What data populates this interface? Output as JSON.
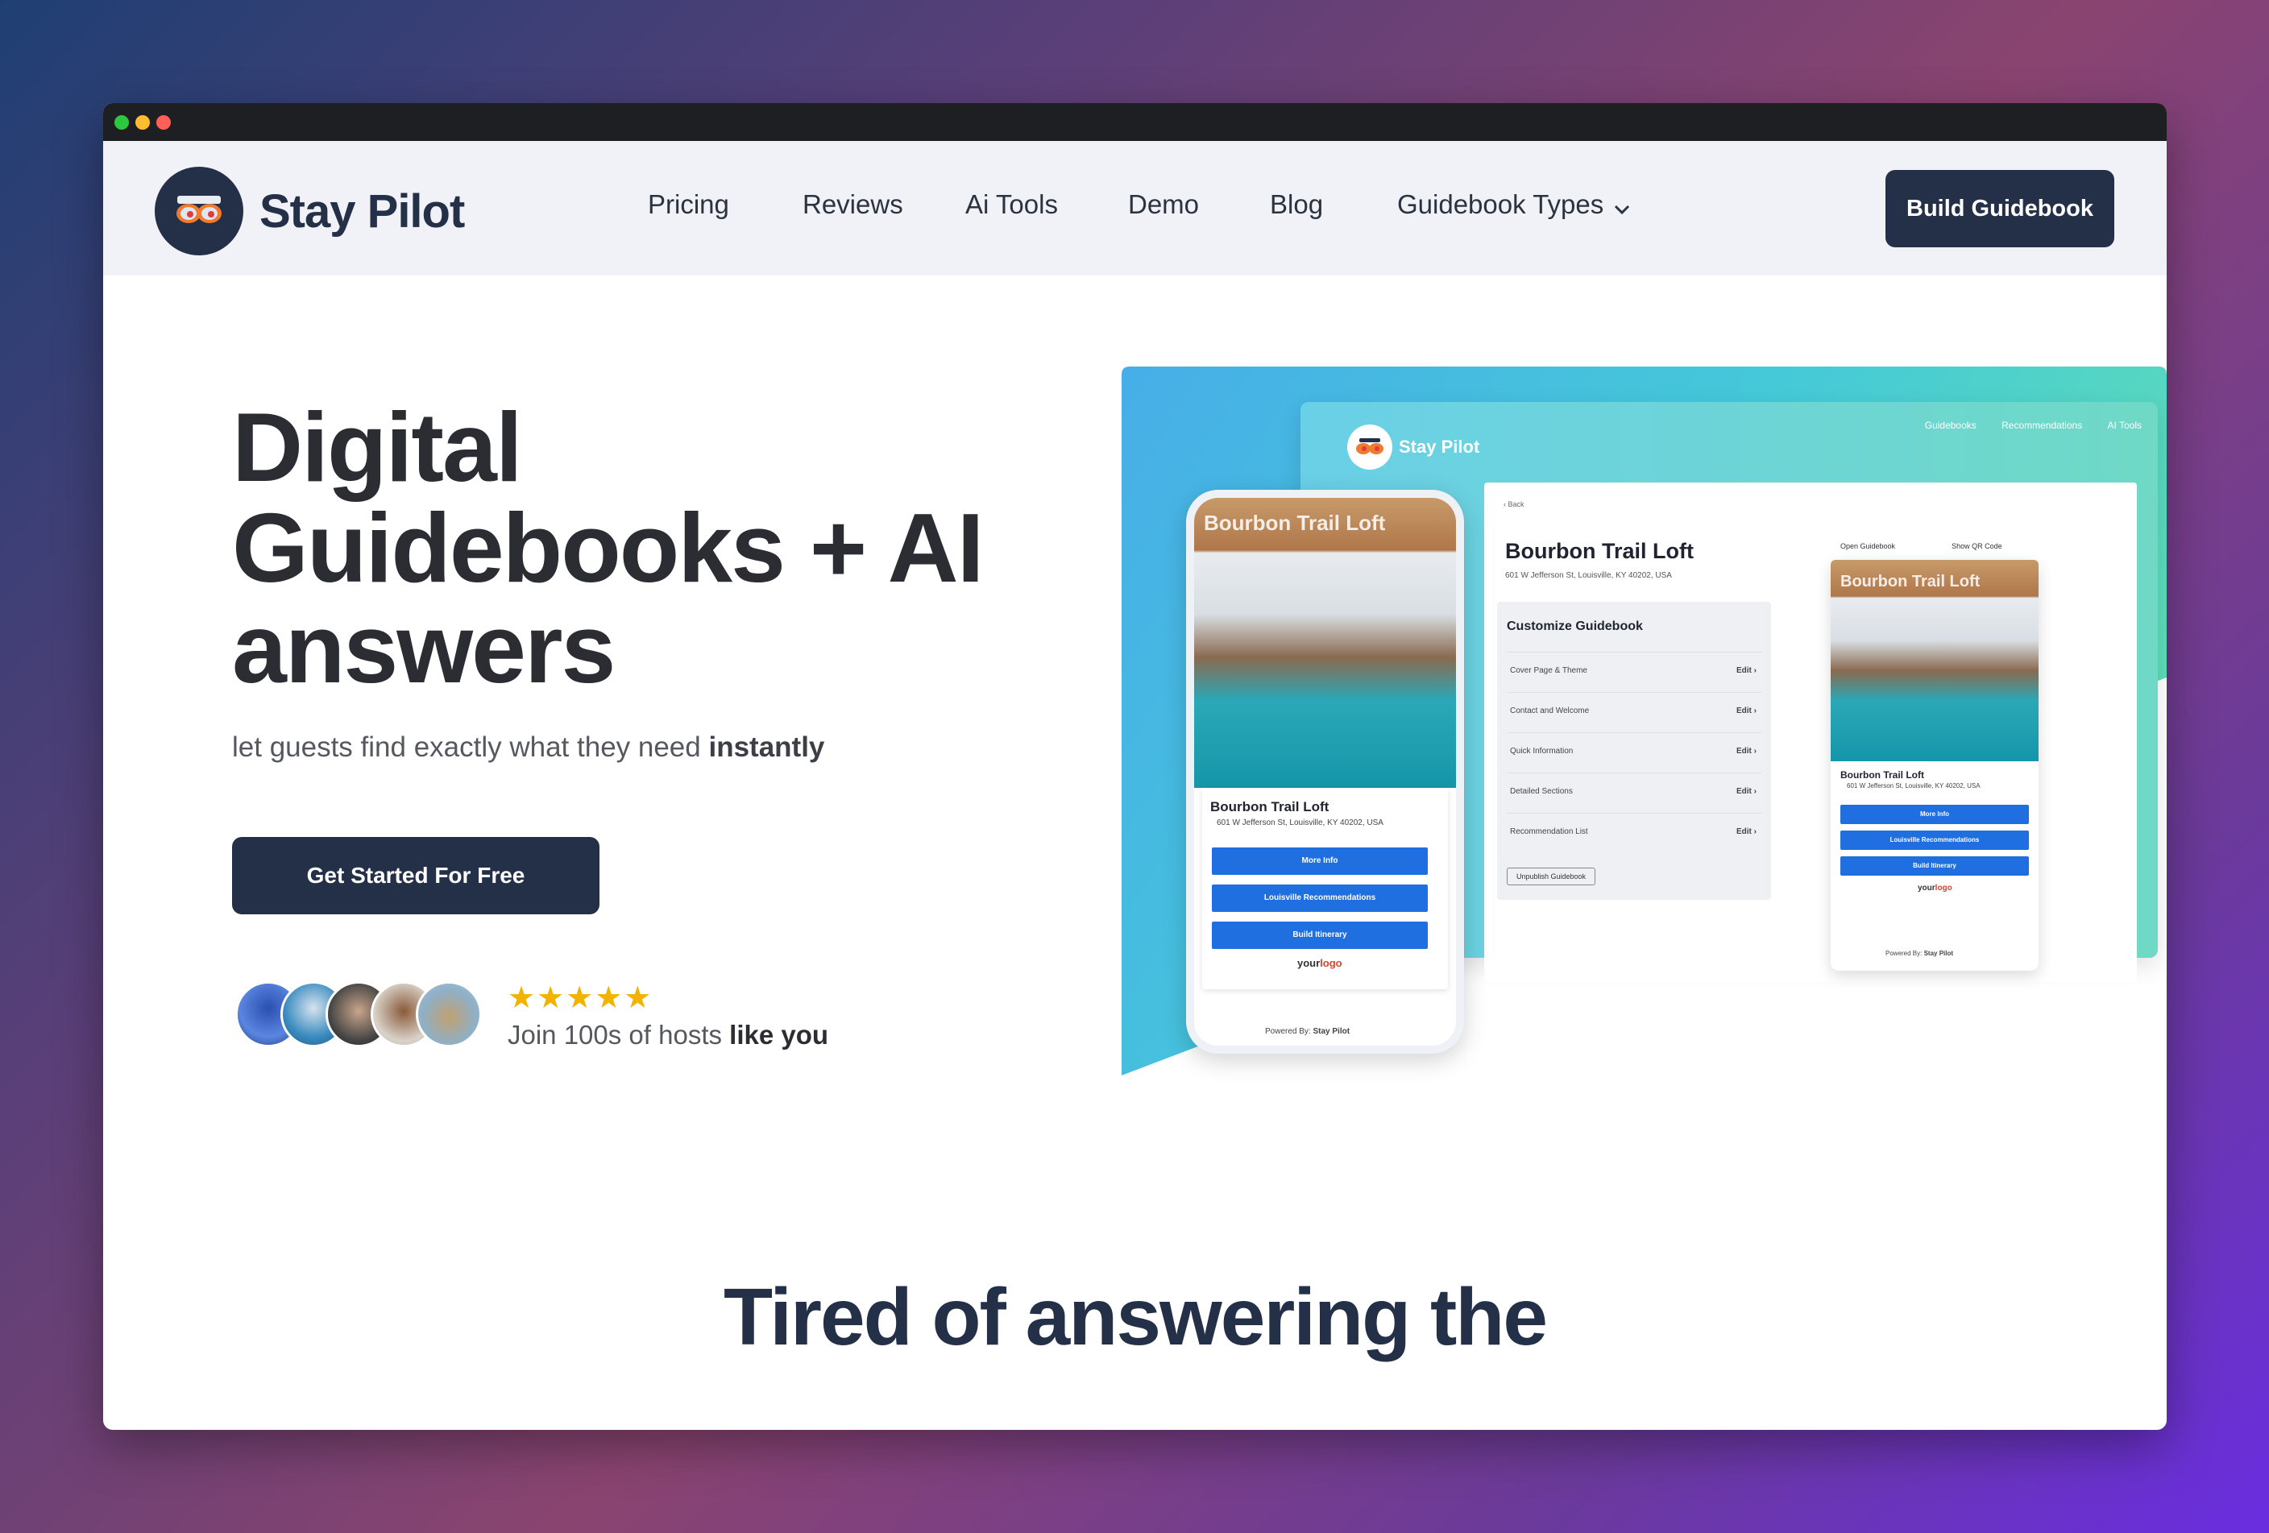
{
  "window": {
    "dots": [
      "close",
      "minimize",
      "zoom"
    ]
  },
  "brand": {
    "name": "Stay Pilot"
  },
  "nav": {
    "links": [
      "Pricing",
      "Reviews",
      "Ai Tools",
      "Demo",
      "Blog",
      "Guidebook Types"
    ],
    "cta": "Build Guidebook"
  },
  "hero": {
    "title_line1": "Digital",
    "title_line2": "Guidebooks + AI",
    "title_line3": "answers",
    "subtitle_pre": "let guests find exactly what they need ",
    "subtitle_bold": "instantly",
    "cta": "Get Started For Free",
    "stars": "★★★★★",
    "join_pre": "Join 100s of hosts ",
    "join_bold": "like you"
  },
  "mockup": {
    "desktop": {
      "brand": "Stay Pilot",
      "links": [
        "Guidebooks",
        "Recommendations",
        "AI Tools"
      ],
      "back": "‹  Back",
      "title": "Bourbon Trail Loft",
      "address": "601 W Jefferson St, Louisville, KY 40202, USA",
      "customize_title": "Customize Guidebook",
      "rows": [
        "Cover Page & Theme",
        "Contact and Welcome",
        "Quick Information",
        "Detailed Sections",
        "Recommendation List"
      ],
      "edit": "Edit  ›",
      "unpublish": "Unpublish Guidebook",
      "open_link": "Open Guidebook",
      "qr_link": "Show QR Code"
    },
    "phone": {
      "photo_title": "Bourbon Trail Loft",
      "name": "Bourbon Trail Loft",
      "address": "601 W Jefferson St, Louisville, KY 40202, USA",
      "buttons": [
        "More Info",
        "Louisville Recommendations",
        "Build Itinerary"
      ],
      "logo_your": "your",
      "logo_logo": "logo",
      "powered": "Powered By:",
      "powered_brand": "Stay Pilot"
    }
  },
  "section2": {
    "title": "Tired of answering the"
  },
  "colors": {
    "primary": "#243047",
    "accent_blue": "#1f6fe0",
    "star": "#f2b200"
  }
}
